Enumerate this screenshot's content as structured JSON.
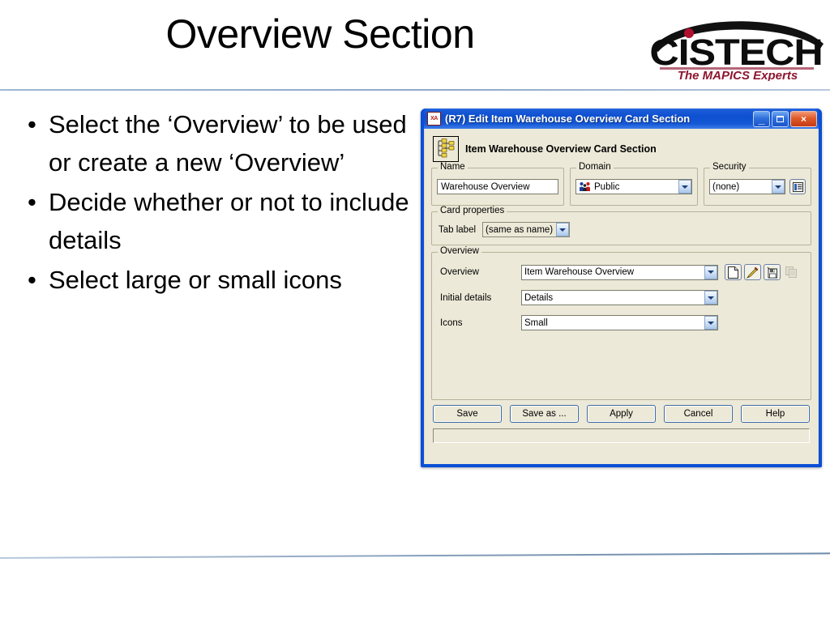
{
  "slide": {
    "title": "Overview Section",
    "bullets": [
      "Select the ‘Overview’ to be used or create a new ‘Overview’",
      "Decide whether or not to include details",
      "Select large or small icons"
    ],
    "bullet_marker": "•"
  },
  "logo": {
    "wordmark": "CISTECH",
    "tagline": "The MAPICS Experts",
    "wordmark_color": "#0d0d0d",
    "tagline_color": "#8e1630",
    "accent_dot_color": "#b01030"
  },
  "dialog": {
    "app_icon_label": "XA",
    "title": "(R7) Edit Item Warehouse Overview Card Section",
    "window_buttons": {
      "minimize": "minimize-icon",
      "maximize": "maximize-icon",
      "close": "×"
    },
    "heading": "Item Warehouse Overview Card Section",
    "heading_icon": "tree-hierarchy-icon",
    "groups": {
      "name": {
        "label": "Name",
        "value": "Warehouse Overview"
      },
      "domain": {
        "label": "Domain",
        "value": "Public",
        "icon": "people-public-icon"
      },
      "security": {
        "label": "Security",
        "value": "(none)",
        "button_icon": "details-list-icon"
      },
      "card_properties": {
        "label": "Card properties",
        "tab_label_field": "Tab label",
        "tab_label_value": "(same as name)"
      },
      "overview": {
        "label": "Overview",
        "rows": [
          {
            "label": "Overview",
            "value": "Item Warehouse Overview"
          },
          {
            "label": "Initial details",
            "value": "Details"
          },
          {
            "label": "Icons",
            "value": "Small"
          }
        ],
        "tools": [
          {
            "name": "new-document-icon",
            "enabled": true
          },
          {
            "name": "edit-pencil-icon",
            "enabled": true
          },
          {
            "name": "save-floppy-icon",
            "enabled": true
          },
          {
            "name": "copy-icon",
            "enabled": false
          }
        ]
      }
    },
    "buttons": [
      "Save",
      "Save as ...",
      "Apply",
      "Cancel",
      "Help"
    ],
    "status_text": "",
    "colors": {
      "titlebar_blue": "#0d4fd0",
      "frame_blue": "#0a4fd6",
      "face": "#ece9d8",
      "close_red": "#e05a28"
    }
  }
}
